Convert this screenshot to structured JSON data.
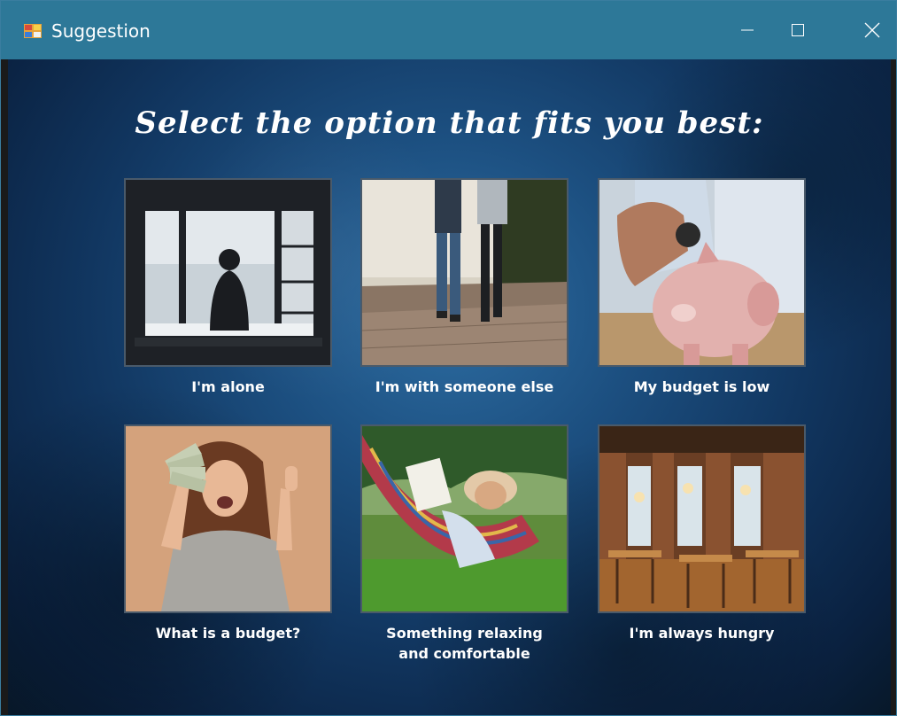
{
  "window": {
    "title": "Suggestion",
    "controls": [
      "minimize",
      "maximize",
      "close"
    ]
  },
  "heading": "Select the option that fits you best:",
  "options": [
    {
      "label": "I'm alone",
      "image": "person-at-window"
    },
    {
      "label": "I'm with someone else",
      "image": "couple-walking"
    },
    {
      "label": "My budget is low",
      "image": "piggy-bank"
    },
    {
      "label": "What is a budget?",
      "image": "woman-with-cash"
    },
    {
      "label": "Something relaxing\nand comfortable",
      "image": "person-in-hammock"
    },
    {
      "label": "I'm always hungry",
      "image": "restaurant-interior"
    }
  ],
  "colors": {
    "titlebar": "#2d7898",
    "background": "#113660",
    "text": "#ffffff"
  }
}
